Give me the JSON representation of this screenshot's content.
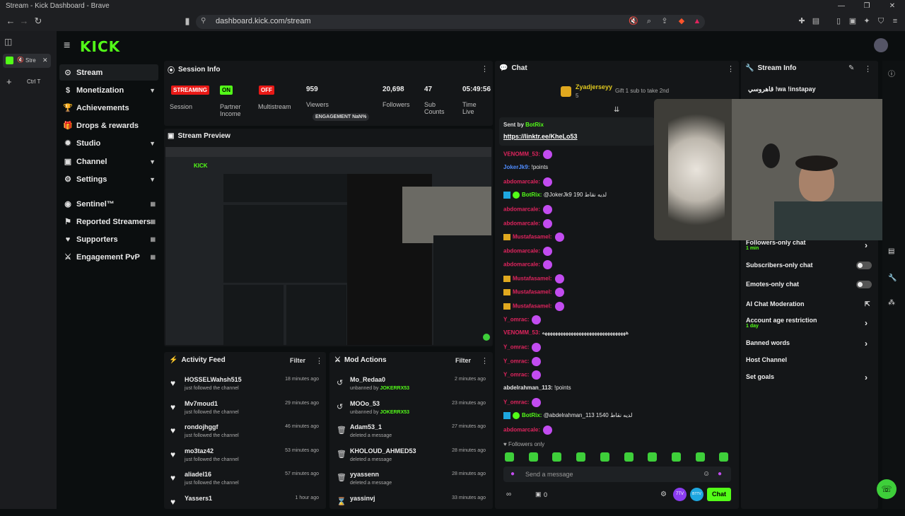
{
  "browser": {
    "title": "Stream - Kick Dashboard - Brave",
    "url": "dashboard.kick.com/stream",
    "tab_label": "Stre",
    "tab_shortcut": "Ctrl T"
  },
  "app": {
    "logo": "KICK"
  },
  "sidebar": {
    "items": [
      {
        "label": "Stream",
        "icon": "stream-icon",
        "active": true
      },
      {
        "label": "Monetization",
        "icon": "dollar-icon",
        "chevron": true
      },
      {
        "label": "Achievements",
        "icon": "trophy-icon"
      },
      {
        "label": "Drops & rewards",
        "icon": "gift-icon"
      },
      {
        "label": "Studio",
        "icon": "studio-icon",
        "chevron": true
      },
      {
        "label": "Channel",
        "icon": "channel-icon",
        "chevron": true
      },
      {
        "label": "Settings",
        "icon": "gear-icon",
        "chevron": true
      },
      {
        "label": "Sentinel™",
        "icon": "shield-icon",
        "ext": true
      },
      {
        "label": "Reported Streamers",
        "icon": "flag-icon",
        "ext": true
      },
      {
        "label": "Supporters",
        "icon": "heart-icon",
        "ext": true
      },
      {
        "label": "Engagement PvP",
        "icon": "pvp-icon",
        "ext": true
      }
    ]
  },
  "session": {
    "title": "Session Info",
    "streaming": "STREAMING",
    "session_label": "Session",
    "on": "ON",
    "partner_label": "Partner Income",
    "off": "OFF",
    "multistream_label": "Multistream",
    "viewers": "959",
    "viewers_label": "Viewers",
    "engagement": "ENGAGEMENT NaN%",
    "followers": "20,698",
    "followers_label": "Followers",
    "subs": "47",
    "subs_label": "Sub Counts",
    "time": "05:49:56",
    "time_label": "Time Live"
  },
  "preview": {
    "title": "Stream Preview"
  },
  "activity": {
    "title": "Activity Feed",
    "filter": "Filter",
    "items": [
      {
        "name": "HOSSELWahsh515",
        "sub": "just followed the channel",
        "time": "18 minutes ago"
      },
      {
        "name": "Mv7moud1",
        "sub": "just followed the channel",
        "time": "29 minutes ago"
      },
      {
        "name": "rondojhggf",
        "sub": "just followed the channel",
        "time": "46 minutes ago"
      },
      {
        "name": "mo3taz42",
        "sub": "just followed the channel",
        "time": "53 minutes ago"
      },
      {
        "name": "aliadel16",
        "sub": "just followed the channel",
        "time": "57 minutes ago"
      },
      {
        "name": "Yassers1",
        "sub": "",
        "time": "1 hour ago"
      }
    ]
  },
  "mod": {
    "title": "Mod Actions",
    "filter": "Filter",
    "items": [
      {
        "name": "Mo_Redaa0",
        "sub": "unbanned by",
        "by": "JOKERRX53",
        "time": "2 minutes ago"
      },
      {
        "name": "MOOo_53",
        "sub": "unbanned by",
        "by": "JOKERRX53",
        "time": "23 minutes ago"
      },
      {
        "name": "Adam53_1",
        "sub": "deleted a message",
        "by": "",
        "time": "27 minutes ago"
      },
      {
        "name": "KHOLOUD_AHMED53",
        "sub": "deleted a message",
        "by": "",
        "time": "28 minutes ago"
      },
      {
        "name": "yyassenn",
        "sub": "deleted a message",
        "by": "",
        "time": "28 minutes ago"
      },
      {
        "name": "yassinvj",
        "sub": "",
        "by": "",
        "time": "33 minutes ago"
      }
    ]
  },
  "chat": {
    "title": "Chat",
    "pinned_user": "Zyadjerseyy",
    "pinned_count": "5",
    "gift_text": "Gift 1 sub to take 2nd",
    "sent_by": "Sent by",
    "sent_bot": "BotRix",
    "link": "https://linktr.ee/KheLo53",
    "lines": [
      {
        "user": "VENOMM_53:",
        "color": "#e0245e",
        "text": ""
      },
      {
        "user": "JokerJk9:",
        "color": "#4f8cff",
        "text": "!points"
      },
      {
        "user": "abdomarcale:",
        "color": "#e0245e",
        "text": ""
      },
      {
        "user": "BotRix:",
        "color": "#53fc18",
        "text": "@JokerJk9 190 لديه نقاط"
      },
      {
        "user": "abdomarcale:",
        "color": "#e0245e",
        "text": ""
      },
      {
        "user": "abdomarcale:",
        "color": "#e0245e",
        "text": ""
      },
      {
        "user": "Mustafasamel:",
        "color": "#e0245e",
        "text": ""
      },
      {
        "user": "abdomarcale:",
        "color": "#e0245e",
        "text": ""
      },
      {
        "user": "abdomarcale:",
        "color": "#e0245e",
        "text": ""
      },
      {
        "user": "Mustafasamel:",
        "color": "#e0245e",
        "text": ""
      },
      {
        "user": "Mustafasamel:",
        "color": "#e0245e",
        "text": ""
      },
      {
        "user": "Mustafasamel:",
        "color": "#e0245e",
        "text": ""
      },
      {
        "user": "Y_omrac:",
        "color": "#e0245e",
        "text": ""
      },
      {
        "user": "VENOMM_53:",
        "color": "#e0245e",
        "text": "ههههههههههههههههههههههههههههههههه"
      },
      {
        "user": "Y_omrac:",
        "color": "#e0245e",
        "text": ""
      },
      {
        "user": "Y_omrac:",
        "color": "#e0245e",
        "text": ""
      },
      {
        "user": "Y_omrac:",
        "color": "#e0245e",
        "text": ""
      },
      {
        "user": "abdelrahman_113:",
        "color": "#e8e8e8",
        "text": "!points"
      },
      {
        "user": "Y_omrac:",
        "color": "#e0245e",
        "text": ""
      },
      {
        "user": "BotRix:",
        "color": "#53fc18",
        "text": "@abdelrahman_113 1540 لديه نقاط"
      },
      {
        "user": "abdomarcale:",
        "color": "#e0245e",
        "text": ""
      }
    ],
    "followers_only": "Followers only",
    "placeholder": "Send a message",
    "count": "0",
    "send": "Chat",
    "b7tv": "7TV",
    "bbttv": "BTTV"
  },
  "stream_info": {
    "title": "Stream Info",
    "stream_title": "قاهروسي !wa !instapay",
    "items": [
      {
        "label": "Followers-only chat",
        "sub": "1 min",
        "control": "chevron"
      },
      {
        "label": "Subscribers-only chat",
        "sub": "",
        "control": "toggle"
      },
      {
        "label": "Emotes-only chat",
        "sub": "",
        "control": "toggle"
      },
      {
        "label": "AI Chat Moderation",
        "sub": "",
        "control": "external"
      },
      {
        "label": "Account age restriction",
        "sub": "1 day",
        "control": "chevron"
      },
      {
        "label": "Banned words",
        "sub": "",
        "control": "chevron"
      },
      {
        "label": "Host Channel",
        "sub": "",
        "control": "none"
      },
      {
        "label": "Set goals",
        "sub": "",
        "control": "chevron"
      }
    ]
  },
  "colors": {
    "accent": "#53fc18",
    "streaming": "#e91916",
    "panel": "#141618"
  }
}
